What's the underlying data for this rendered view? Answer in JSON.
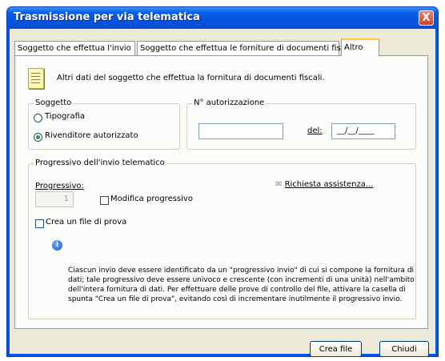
{
  "window": {
    "title": "Trasmissione per via telematica",
    "close_glyph": "X"
  },
  "tabs": [
    {
      "label": "Soggetto che effettua l'invio"
    },
    {
      "label": "Soggetto che effettua le forniture di documenti fiscali"
    },
    {
      "label": "Altro"
    }
  ],
  "intro_text": "Altri dati del soggetto che effettua la fornitura di documenti fiscali.",
  "soggetto": {
    "legend": "Soggetto",
    "options": [
      {
        "label": "Tipografia",
        "checked": false
      },
      {
        "label": "Rivenditore autorizzato",
        "checked": true
      }
    ]
  },
  "autorizzazione": {
    "legend": "N° autorizzazione",
    "number_value": "",
    "del_label": "del:",
    "date_value": "__/__/____"
  },
  "progressivo": {
    "legend": "Progressivo dell'invio telematico",
    "label": "Progressivo:",
    "value": "1",
    "modifica_label": "Modifica progressivo",
    "crea_file_prova_label": "Crea un file di prova",
    "assistenza_label": "Richiesta assistenza...",
    "info_text": "Ciascun invio deve essere identificato da un \"progressivo invio\" di cui si compone la fornitura di dati; tale progressivo deve essere univoco e crescente (con incrementi di una unità) nell'ambito dell'intera fornitura di dati. Per effettuare delle prove di controllo del file, attivare la casella di spunta \"Crea un file di prova\", evitando così di incrementare inutilmente il progressivo invio."
  },
  "buttons": {
    "crea_file": "Crea file",
    "chiudi": "Chiudi"
  }
}
